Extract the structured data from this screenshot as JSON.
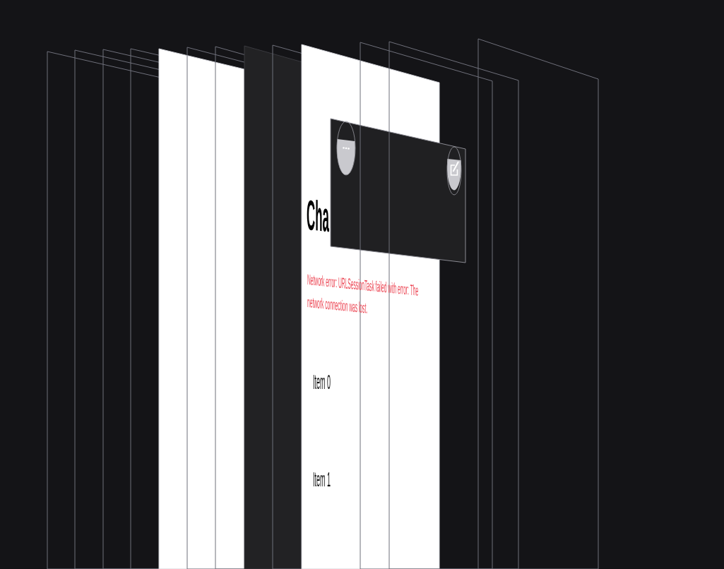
{
  "view_debugger": {
    "layers": [
      {
        "kind": "outline"
      },
      {
        "kind": "outline"
      },
      {
        "kind": "outline"
      },
      {
        "kind": "outline"
      },
      {
        "kind": "light"
      },
      {
        "kind": "outline"
      },
      {
        "kind": "outline"
      },
      {
        "kind": "dark"
      },
      {
        "kind": "outline"
      },
      {
        "kind": "light"
      },
      {
        "kind": "outline"
      },
      {
        "kind": "outline"
      },
      {
        "kind": "outline"
      }
    ],
    "screen": {
      "title": "Cha",
      "error_message": "Network error: URLSessionTask failed with error: The network connection was lost.",
      "items": [
        "Item 0",
        "Item 1"
      ]
    }
  }
}
